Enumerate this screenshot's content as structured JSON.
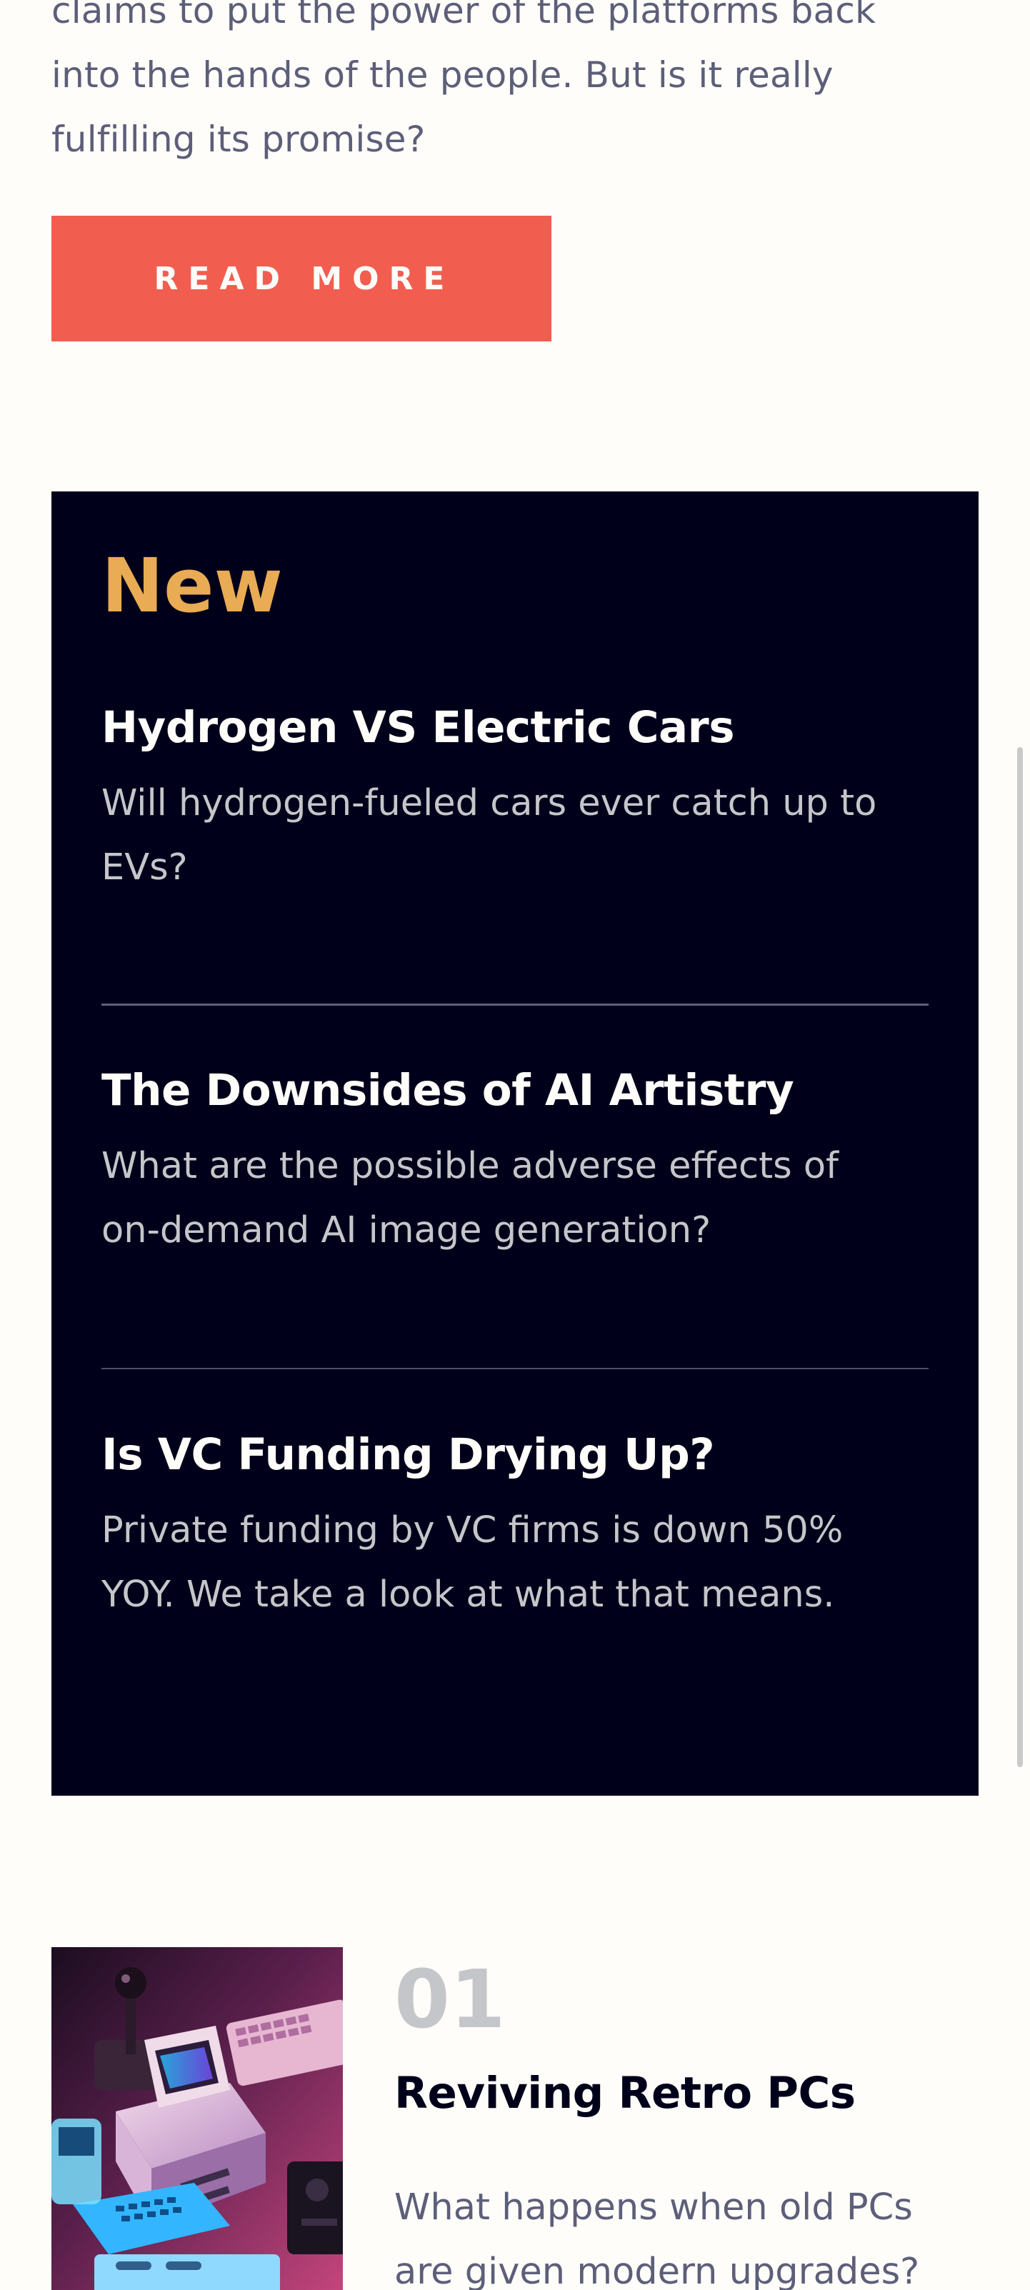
{
  "intro": {
    "lines": [
      "claims to put the power of the platforms back",
      "into the hands of the people. But is it really",
      "fulfilling its promise?"
    ],
    "read_more_label": "READ MORE"
  },
  "new_section": {
    "heading": "New",
    "items": [
      {
        "title": "Hydrogen VS Electric Cars",
        "desc_lines": [
          "Will hydrogen-fueled cars ever catch up to",
          "EVs?"
        ]
      },
      {
        "title": "The Downsides of AI Artistry",
        "desc_lines": [
          "What are the possible adverse effects of",
          "on-demand AI image generation?"
        ]
      },
      {
        "title": "Is VC Funding Drying Up?",
        "desc_lines": [
          "Private funding by VC firms is down 50%",
          "YOY. We take a look at what that means."
        ]
      }
    ]
  },
  "articles": [
    {
      "number": "01",
      "title": "Reviving Retro PCs",
      "desc_lines": [
        "What happens when old PCs",
        "are given modern upgrades?"
      ],
      "image_alt": "retro-pc-image"
    }
  ],
  "colors": {
    "background": "#fffdfa",
    "button": "#f15e50",
    "panel": "#00001a",
    "accent": "#e9ab53",
    "text_muted": "#5d5f79",
    "number_gray": "#c5c6c9"
  }
}
